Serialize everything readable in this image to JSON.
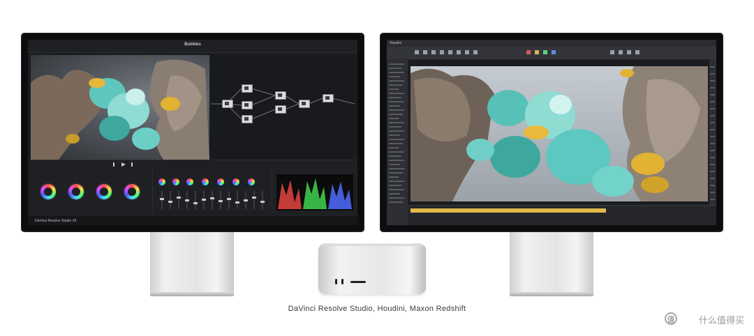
{
  "caption": "DaVinci Resolve Studio, Houdini, Maxon Redshift",
  "left_monitor": {
    "app_title": "Bubbles",
    "brand": "DaVinci Resolve Studio 18"
  },
  "right_monitor": {
    "app_name": "Houdini"
  },
  "watermark": {
    "text": "什么值得买",
    "logo": "值"
  },
  "colors": {
    "bezel": "#0d0d0f",
    "stand": "#e4e4e6",
    "accent_gold": "#e2b84a"
  },
  "icons": [
    "color-wheel-icon",
    "node-icon",
    "play-icon"
  ]
}
